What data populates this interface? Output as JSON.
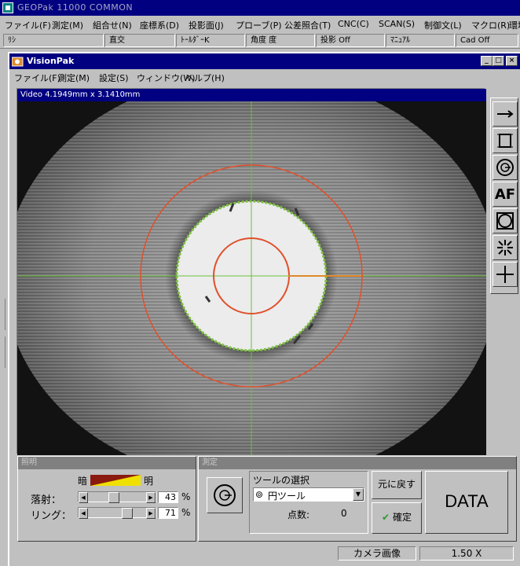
{
  "outer_app": {
    "title": "GEOPak 11000  COMMON",
    "menu": [
      "ファイル(F)",
      "測定(M)",
      "組合せ(N)",
      "座標系(D)",
      "投影面(J)",
      "プローブ(P)",
      "公差照合(T)",
      "CNC(C)",
      "SCAN(S)",
      "制御文(L)",
      "マクロ(R)",
      "環境"
    ],
    "status_cells": [
      "ﾘｼ",
      "直交",
      "ﾄｰﾙﾀﾞｰK",
      "角度 度",
      "投影 Off",
      "ﾏﾆｭｱﾙ",
      "Cad Off"
    ]
  },
  "vision_window": {
    "title": "VisionPak",
    "menu": [
      "ファイル(F)",
      "測定(M)",
      "設定(S)",
      "ウィンドウ(W)",
      "ヘルプ(H)"
    ],
    "window_buttons": [
      "_",
      "□",
      "×"
    ]
  },
  "video": {
    "caption": "Video 4.1949mm x 3.1410mm"
  },
  "toolbar": {
    "buttons": [
      "arrow-right-icon",
      "bracket-frame-icon",
      "circle-tool-icon",
      "AF",
      "square-circle-icon",
      "star-points-icon",
      "crosshair-icon"
    ]
  },
  "lighting": {
    "header": "照明",
    "dark_label": "暗",
    "bright_label": "明",
    "reflect_label": "落射：",
    "reflect_value": "43",
    "reflect_pct": 43,
    "ring_label": "リング：",
    "ring_value": "71",
    "ring_pct": 71,
    "unit": "%"
  },
  "measure": {
    "header": "測定",
    "tool_select_label": "ツールの選択",
    "tool_selected": "円ツール",
    "points_label": "点数:",
    "points_value": "0",
    "back_label": "元に戻す",
    "confirm_label": "確定",
    "data_label": "DATA"
  },
  "statusbar": {
    "camera_label": "カメラ画像",
    "zoom": "1.50 X"
  },
  "colors": {
    "titlebar": "#000080",
    "crosshair": "#6bbf3a",
    "measure_circle": "#e0502a",
    "edge": "#7ec040"
  }
}
